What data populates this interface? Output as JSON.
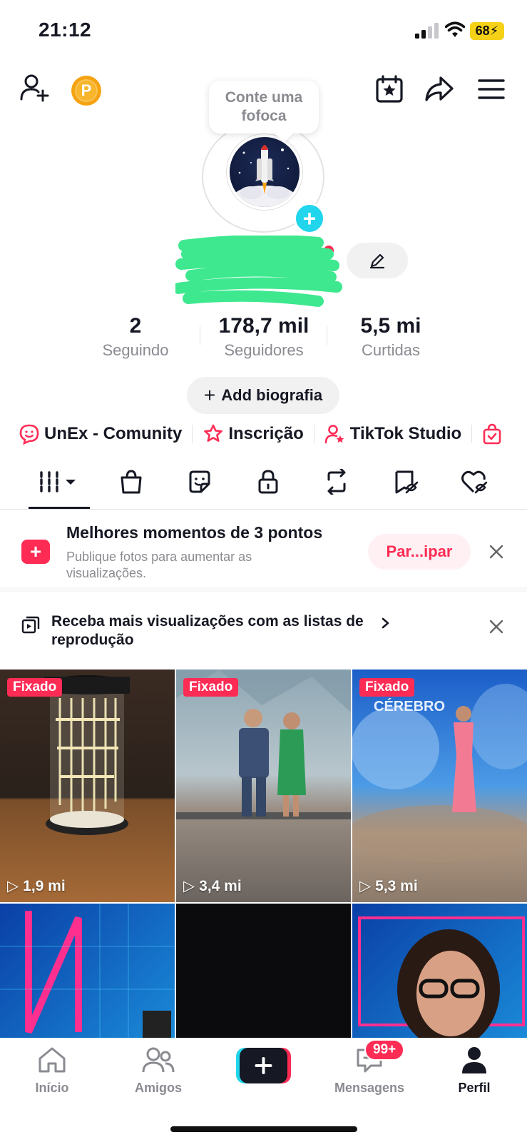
{
  "status_bar": {
    "time": "21:12",
    "battery": "68"
  },
  "header": {
    "coin_label": "P"
  },
  "tooltip": {
    "text": "Conte uma fofoca"
  },
  "profile": {
    "username": "...",
    "handle": "@"
  },
  "stats": [
    {
      "value": "2",
      "label": "Seguindo"
    },
    {
      "value": "178,7 mil",
      "label": "Seguidores"
    },
    {
      "value": "5,5 mi",
      "label": "Curtidas"
    }
  ],
  "bio_button": {
    "label": "Add biografia"
  },
  "links": [
    {
      "label": "UnEx - Comunity",
      "icon": "smile-bubble-icon"
    },
    {
      "label": "Inscrição",
      "icon": "star-ribbon-icon"
    },
    {
      "label": "TikTok Studio",
      "icon": "person-star-icon"
    }
  ],
  "promo": {
    "title": "Melhores momentos de 3 pontos",
    "subtitle": "Publique fotos para aumentar as visualizações.",
    "button": "Par...ipar"
  },
  "playlist_banner": {
    "text": "Receba mais visualizações com as listas de reprodução"
  },
  "videos": [
    {
      "pinned": "Fixado",
      "views": "1,9 mi"
    },
    {
      "pinned": "Fixado",
      "views": "3,4 mi"
    },
    {
      "pinned": "Fixado",
      "views": "5,3 mi"
    },
    {
      "pinned": "",
      "views": ""
    },
    {
      "pinned": "",
      "views": ""
    },
    {
      "pinned": "",
      "views": ""
    }
  ],
  "bottom_nav": {
    "home": "Início",
    "friends": "Amigos",
    "messages": "Mensagens",
    "messages_badge": "99+",
    "profile": "Perfil"
  },
  "colors": {
    "accent": "#fe2c55",
    "cyan": "#20d5ec",
    "scribble": "#3ee88f"
  }
}
